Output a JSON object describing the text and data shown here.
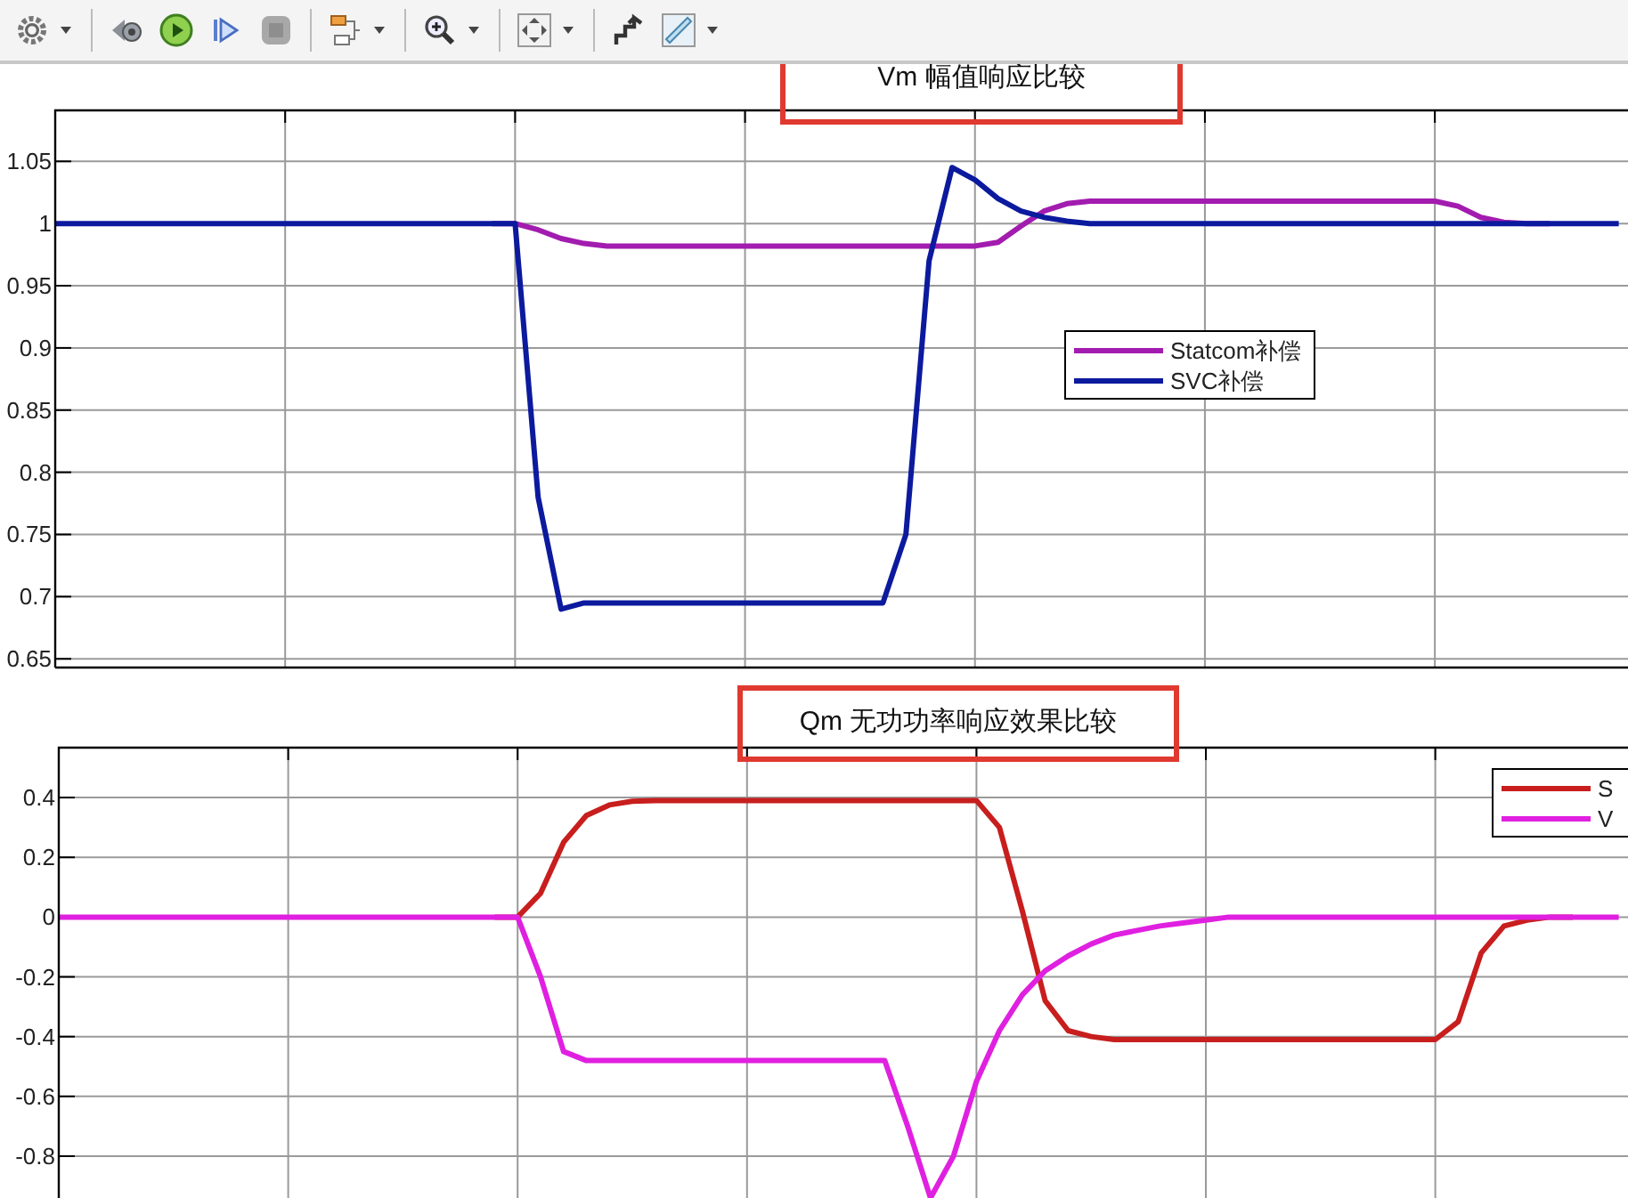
{
  "toolbar": {
    "items": [
      {
        "kind": "settings",
        "dropdown": true
      },
      {
        "kind": "separator"
      },
      {
        "kind": "step-back",
        "dropdown": false
      },
      {
        "kind": "play",
        "dropdown": false
      },
      {
        "kind": "step-forward",
        "dropdown": false
      },
      {
        "kind": "stop",
        "dropdown": false
      },
      {
        "kind": "separator"
      },
      {
        "kind": "blocks",
        "dropdown": true
      },
      {
        "kind": "separator"
      },
      {
        "kind": "zoom",
        "dropdown": true
      },
      {
        "kind": "separator"
      },
      {
        "kind": "fit",
        "dropdown": true
      },
      {
        "kind": "separator"
      },
      {
        "kind": "staircase",
        "dropdown": false
      },
      {
        "kind": "ruler",
        "dropdown": true
      }
    ]
  },
  "panels": [
    {
      "highlighted": true,
      "chart_data": {
        "type": "line",
        "title": "Vm 幅值响应比较",
        "categories": [
          null,
          null,
          null,
          null,
          null,
          null,
          null,
          null,
          null,
          null,
          null,
          null,
          null,
          null,
          null,
          null,
          null,
          null,
          null,
          null,
          null,
          null,
          null,
          null,
          null,
          null,
          null,
          null,
          null,
          null,
          null,
          null,
          null,
          null,
          null,
          null,
          null,
          null,
          null,
          null,
          null,
          null,
          null,
          null,
          null,
          null,
          null,
          null,
          null,
          null,
          null,
          null,
          null,
          null,
          null,
          null,
          null,
          null,
          null,
          null,
          null,
          null,
          null,
          null,
          null,
          null,
          null,
          null,
          null
        ],
        "series": [
          {
            "name": "Statcom补偿",
            "color": "#a21caf",
            "values": [
              null,
              null,
              null,
              null,
              null,
              null,
              null,
              null,
              null,
              null,
              null,
              null,
              null,
              null,
              null,
              null,
              null,
              null,
              null,
              1,
              1,
              0.995,
              0.988,
              0.984,
              0.982,
              0.982,
              0.982,
              0.982,
              0.982,
              0.982,
              0.982,
              0.982,
              0.982,
              0.982,
              0.982,
              0.982,
              0.982,
              0.982,
              0.982,
              0.982,
              0.982,
              0.985,
              0.998,
              1.01,
              1.016,
              1.018,
              1.018,
              1.018,
              1.018,
              1.018,
              1.018,
              1.018,
              1.018,
              1.018,
              1.018,
              1.018,
              1.018,
              1.018,
              1.018,
              1.018,
              1.018,
              1.014,
              1.005,
              1.001,
              1,
              1,
              null,
              null,
              null
            ]
          },
          {
            "name": "SVC补偿",
            "color": "#0c1a9e",
            "values": [
              1,
              1,
              1,
              1,
              1,
              1,
              1,
              1,
              1,
              1,
              1,
              1,
              1,
              1,
              1,
              1,
              1,
              1,
              1,
              1,
              1,
              0.78,
              0.69,
              0.695,
              0.695,
              0.695,
              0.695,
              0.695,
              0.695,
              0.695,
              0.695,
              0.695,
              0.695,
              0.695,
              0.695,
              0.695,
              0.695,
              0.75,
              0.97,
              1.045,
              1.035,
              1.02,
              1.01,
              1.005,
              1.002,
              1,
              1,
              1,
              1,
              1,
              1,
              1,
              1,
              1,
              1,
              1,
              1,
              1,
              1,
              1,
              1,
              1,
              1,
              1,
              1,
              1,
              1,
              1,
              1
            ]
          }
        ],
        "ylim": [
          0.643,
          1.091
        ],
        "grid": true,
        "legend": true,
        "yticks": [
          {
            "value": 0.65,
            "label": "0.65"
          },
          {
            "value": 0.7,
            "label": "0.7"
          },
          {
            "value": 0.75,
            "label": "0.75"
          },
          {
            "value": 0.8,
            "label": "0.8"
          },
          {
            "value": 0.85,
            "label": "0.85"
          },
          {
            "value": 0.9,
            "label": "0.9"
          },
          {
            "value": 0.95,
            "label": "0.95"
          },
          {
            "value": 1,
            "label": "1"
          },
          {
            "value": 1.05,
            "label": "1.05"
          }
        ]
      }
    },
    {
      "highlighted": true,
      "chart_data": {
        "type": "line",
        "title": "Qm 无功功率响应效果比较",
        "categories": [
          null,
          null,
          null,
          null,
          null,
          null,
          null,
          null,
          null,
          null,
          null,
          null,
          null,
          null,
          null,
          null,
          null,
          null,
          null,
          null,
          null,
          null,
          null,
          null,
          null,
          null,
          null,
          null,
          null,
          null,
          null,
          null,
          null,
          null,
          null,
          null,
          null,
          null,
          null,
          null,
          null,
          null,
          null,
          null,
          null,
          null,
          null,
          null,
          null,
          null,
          null,
          null,
          null,
          null,
          null,
          null,
          null,
          null,
          null,
          null,
          null,
          null,
          null,
          null,
          null,
          null,
          null,
          null,
          null
        ],
        "series": [
          {
            "name": "S",
            "color": "#c81e1e",
            "values": [
              null,
              null,
              null,
              null,
              null,
              null,
              null,
              null,
              null,
              null,
              null,
              null,
              null,
              null,
              null,
              null,
              null,
              null,
              null,
              0,
              0,
              0.08,
              0.25,
              0.34,
              0.375,
              0.388,
              0.39,
              0.39,
              0.39,
              0.39,
              0.39,
              0.39,
              0.39,
              0.39,
              0.39,
              0.39,
              0.39,
              0.39,
              0.39,
              0.39,
              0.39,
              0.3,
              0.02,
              -0.28,
              -0.38,
              -0.4,
              -0.41,
              -0.41,
              -0.41,
              -0.41,
              -0.41,
              -0.41,
              -0.41,
              -0.41,
              -0.41,
              -0.41,
              -0.41,
              -0.41,
              -0.41,
              -0.41,
              -0.41,
              -0.35,
              -0.12,
              -0.03,
              -0.01,
              0,
              0,
              null,
              null
            ]
          },
          {
            "name": "V",
            "color": "#e020e0",
            "values": [
              0,
              0,
              0,
              0,
              0,
              0,
              0,
              0,
              0,
              0,
              0,
              0,
              0,
              0,
              0,
              0,
              0,
              0,
              0,
              0,
              0,
              -0.2,
              -0.45,
              -0.48,
              -0.48,
              -0.48,
              -0.48,
              -0.48,
              -0.48,
              -0.48,
              -0.48,
              -0.48,
              -0.48,
              -0.48,
              -0.48,
              -0.48,
              -0.48,
              -0.7,
              -0.94,
              -0.8,
              -0.55,
              -0.38,
              -0.26,
              -0.18,
              -0.13,
              -0.09,
              -0.06,
              -0.045,
              -0.03,
              -0.02,
              -0.01,
              0,
              0,
              0,
              0,
              0,
              0,
              0,
              0,
              0,
              0,
              0,
              0,
              0,
              0,
              0,
              0,
              0,
              0
            ]
          }
        ],
        "ylim": [
          -0.94,
          0.567
        ],
        "grid": true,
        "legend": true,
        "yticks": [
          {
            "value": -0.8,
            "label": "-0.8"
          },
          {
            "value": -0.6,
            "label": "-0.6"
          },
          {
            "value": -0.4,
            "label": "-0.4"
          },
          {
            "value": -0.2,
            "label": "-0.2"
          },
          {
            "value": 0,
            "label": "0"
          },
          {
            "value": 0.2,
            "label": "0.2"
          },
          {
            "value": 0.4,
            "label": "0.4"
          }
        ]
      }
    }
  ]
}
